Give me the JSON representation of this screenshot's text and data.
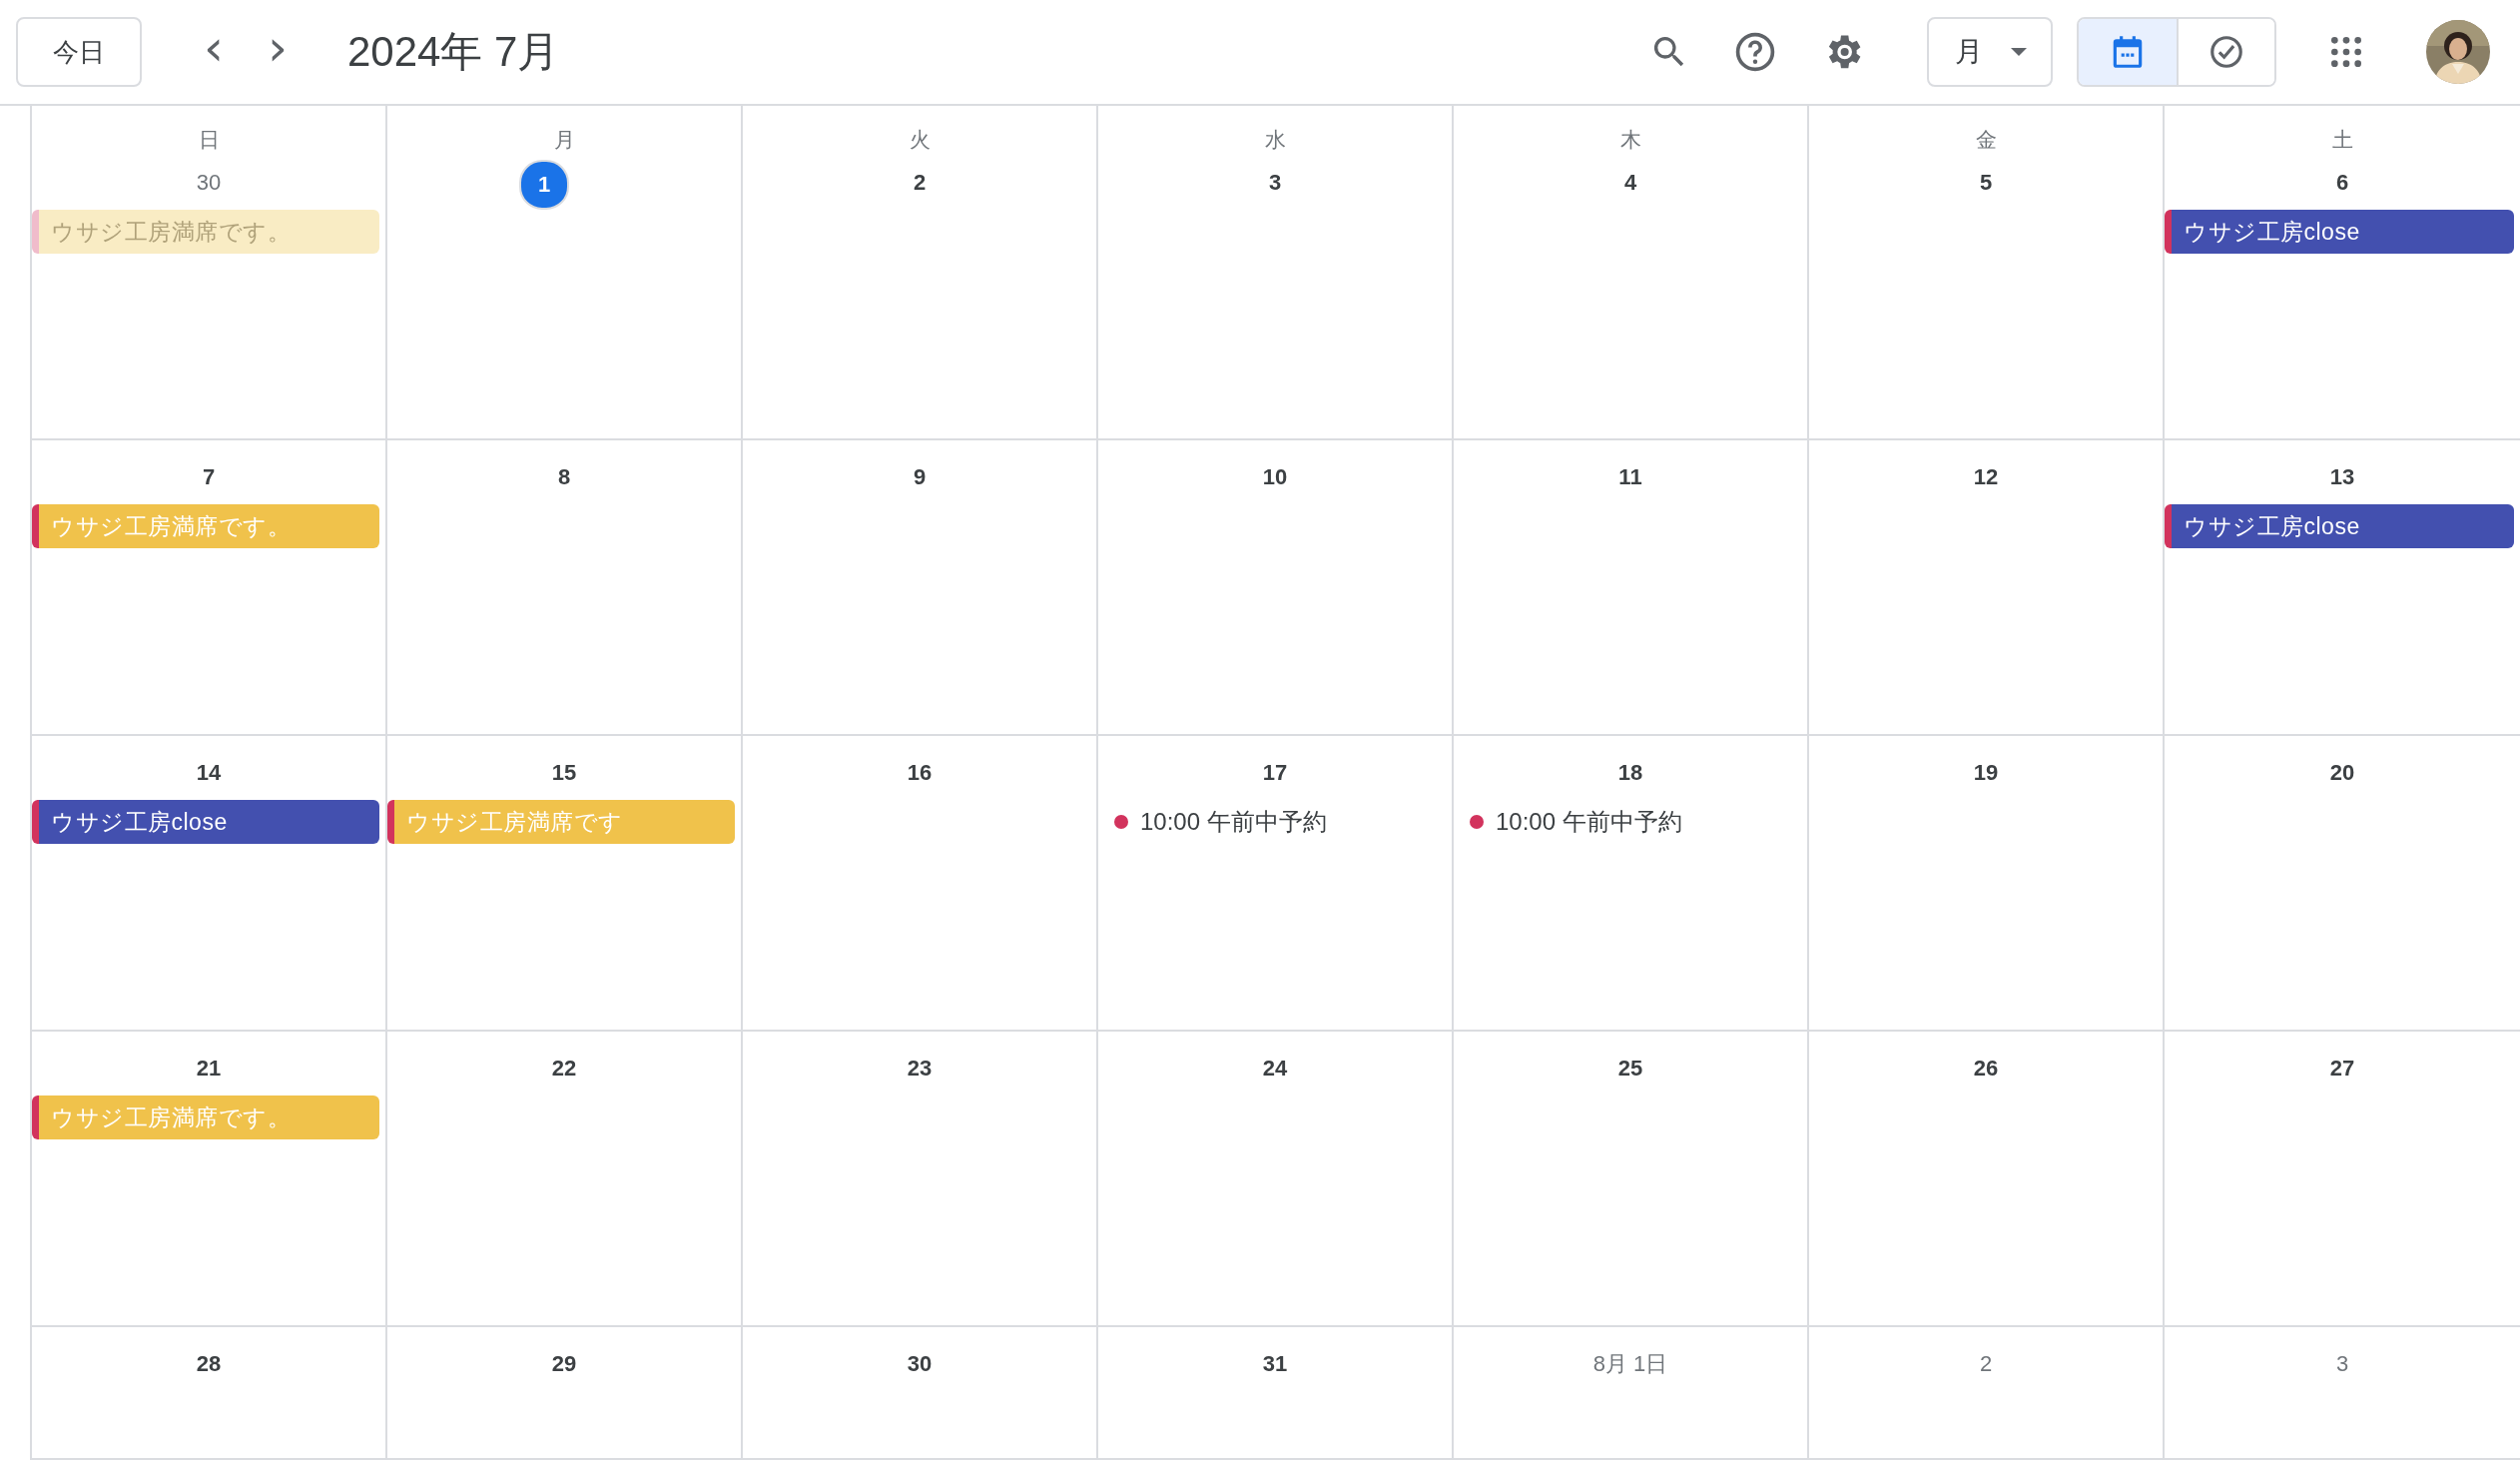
{
  "toolbar": {
    "today_button": "今日",
    "prev": "‹",
    "next": "›",
    "title": "2024年 7月",
    "view_select": "月",
    "view_toggle": [
      {
        "kind": "calendar",
        "selected": true
      },
      {
        "kind": "tasks",
        "selected": false
      }
    ]
  },
  "weekdays": [
    "日",
    "月",
    "火",
    "水",
    "木",
    "金",
    "土"
  ],
  "weeks": [
    {
      "days": [
        {
          "date": "30",
          "outside": true,
          "today": false,
          "events": [
            {
              "kind": "bar",
              "title": "ウサジ工房満席です。",
              "color": "#f9ecc4",
              "faded": true
            }
          ]
        },
        {
          "date": "1",
          "outside": false,
          "today": true
        },
        {
          "date": "2",
          "outside": false,
          "today": false
        },
        {
          "date": "3",
          "outside": false,
          "today": false
        },
        {
          "date": "4",
          "outside": false,
          "today": false
        },
        {
          "date": "5",
          "outside": false,
          "today": false
        },
        {
          "date": "6",
          "outside": false,
          "today": false,
          "events": [
            {
              "kind": "bar",
              "title": "ウサジ工房close",
              "color": "#4350af",
              "faded": false
            }
          ]
        }
      ]
    },
    {
      "days": [
        {
          "date": "7",
          "outside": false,
          "today": false,
          "events": [
            {
              "kind": "bar",
              "title": "ウサジ工房満席です。",
              "color": "#f0c24b",
              "faded": false
            }
          ]
        },
        {
          "date": "8",
          "outside": false,
          "today": false
        },
        {
          "date": "9",
          "outside": false,
          "today": false
        },
        {
          "date": "10",
          "outside": false,
          "today": false
        },
        {
          "date": "11",
          "outside": false,
          "today": false
        },
        {
          "date": "12",
          "outside": false,
          "today": false
        },
        {
          "date": "13",
          "outside": false,
          "today": false,
          "events": [
            {
              "kind": "bar",
              "title": "ウサジ工房close",
              "color": "#4350af",
              "faded": false
            }
          ]
        }
      ]
    },
    {
      "days": [
        {
          "date": "14",
          "outside": false,
          "today": false,
          "events": [
            {
              "kind": "bar",
              "title": "ウサジ工房close",
              "color": "#4350af",
              "faded": false
            }
          ]
        },
        {
          "date": "15",
          "outside": false,
          "today": false,
          "events": [
            {
              "kind": "bar",
              "title": "ウサジ工房満席です",
              "color": "#f0c24b",
              "faded": false
            }
          ]
        },
        {
          "date": "16",
          "outside": false,
          "today": false
        },
        {
          "date": "17",
          "outside": false,
          "today": false,
          "events": [
            {
              "kind": "timed",
              "time": "10:00",
              "title": "午前中予約",
              "color": "#d2335d"
            }
          ]
        },
        {
          "date": "18",
          "outside": false,
          "today": false,
          "events": [
            {
              "kind": "timed",
              "time": "10:00",
              "title": "午前中予約",
              "color": "#d2335d"
            }
          ]
        },
        {
          "date": "19",
          "outside": false,
          "today": false
        },
        {
          "date": "20",
          "outside": false,
          "today": false
        }
      ]
    },
    {
      "days": [
        {
          "date": "21",
          "outside": false,
          "today": false,
          "events": [
            {
              "kind": "bar",
              "title": "ウサジ工房満席です。",
              "color": "#f0c24b",
              "faded": false
            }
          ]
        },
        {
          "date": "22",
          "outside": false,
          "today": false
        },
        {
          "date": "23",
          "outside": false,
          "today": false
        },
        {
          "date": "24",
          "outside": false,
          "today": false
        },
        {
          "date": "25",
          "outside": false,
          "today": false
        },
        {
          "date": "26",
          "outside": false,
          "today": false
        },
        {
          "date": "27",
          "outside": false,
          "today": false
        }
      ]
    },
    {
      "days": [
        {
          "date": "28",
          "outside": false,
          "today": false
        },
        {
          "date": "29",
          "outside": false,
          "today": false
        },
        {
          "date": "30",
          "outside": false,
          "today": false
        },
        {
          "date": "31",
          "outside": false,
          "today": false
        },
        {
          "date": "8月 1日",
          "outside": true,
          "today": false
        },
        {
          "date": "2",
          "outside": true,
          "today": false
        },
        {
          "date": "3",
          "outside": true,
          "today": false
        }
      ]
    }
  ]
}
